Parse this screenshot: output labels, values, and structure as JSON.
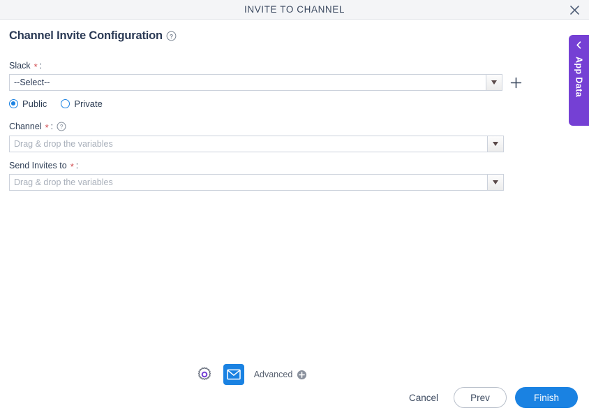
{
  "window": {
    "title": "INVITE TO CHANNEL",
    "close_icon": "close-icon"
  },
  "page": {
    "title": "Channel Invite Configuration",
    "title_help_icon": "help-circle-icon"
  },
  "form": {
    "slack": {
      "label": "Slack",
      "required_mark": "*",
      "colon": ":",
      "value": "--Select--",
      "dropdown_icon": "caret-down-icon",
      "add_icon": "plus-icon"
    },
    "visibility": {
      "options": [
        {
          "label": "Public",
          "selected": true
        },
        {
          "label": "Private",
          "selected": false
        }
      ]
    },
    "channel": {
      "label": "Channel",
      "required_mark": "*",
      "colon": ":",
      "help_icon": "help-circle-icon",
      "placeholder": "Drag & drop the variables",
      "value": "",
      "dropdown_icon": "caret-down-icon"
    },
    "send_invites_to": {
      "label": "Send Invites to",
      "required_mark": "*",
      "colon": ":",
      "placeholder": "Drag & drop the variables",
      "value": "",
      "dropdown_icon": "caret-down-icon"
    }
  },
  "side_tab": {
    "label": "App Data",
    "chevron_icon": "chevron-left-icon",
    "color": "#7540d4"
  },
  "toolbar": {
    "settings_icon": "gear-icon",
    "email_icon": "envelope-icon",
    "advanced_label": "Advanced",
    "advanced_add_icon": "plus-circle-icon"
  },
  "actions": {
    "cancel_label": "Cancel",
    "prev_label": "Prev",
    "finish_label": "Finish"
  },
  "colors": {
    "accent_blue": "#1a82e2",
    "purple": "#7540d4",
    "required_red": "#d0474b",
    "text": "#2e3e55"
  }
}
